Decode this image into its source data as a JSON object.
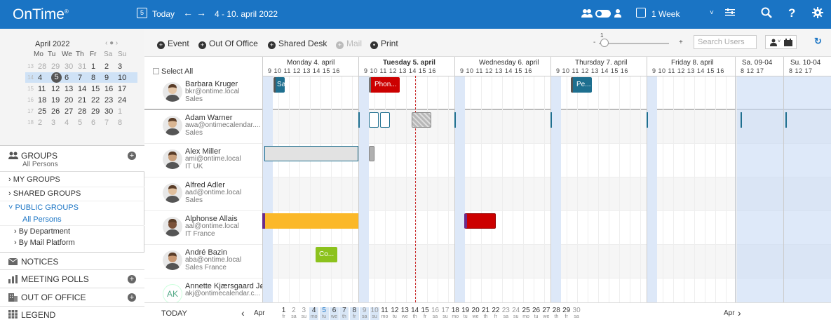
{
  "topbar": {
    "logo": "OnTime",
    "logo_mark": "®",
    "today_icon_num": "5",
    "today": "Today",
    "prev": "←",
    "next": "→",
    "range": "4 - 10. april 2022",
    "view": "1 Week"
  },
  "mini_cal": {
    "month": "April 2022",
    "nav": "‹ ● ›",
    "weekdays": [
      "Mo",
      "Tu",
      "We",
      "Th",
      "Fr",
      "Sa",
      "Su"
    ],
    "weeks": [
      {
        "wk": "13",
        "days": [
          "28",
          "29",
          "30",
          "31",
          "1",
          "2",
          "3"
        ],
        "other": [
          true,
          true,
          true,
          true,
          false,
          false,
          false
        ]
      },
      {
        "wk": "14",
        "days": [
          "4",
          "5",
          "6",
          "7",
          "8",
          "9",
          "10"
        ],
        "other": [
          false,
          false,
          false,
          false,
          false,
          false,
          false
        ]
      },
      {
        "wk": "15",
        "days": [
          "11",
          "12",
          "13",
          "14",
          "15",
          "16",
          "17"
        ],
        "other": [
          false,
          false,
          false,
          false,
          false,
          false,
          false
        ]
      },
      {
        "wk": "16",
        "days": [
          "18",
          "19",
          "20",
          "21",
          "22",
          "23",
          "24"
        ],
        "other": [
          false,
          false,
          false,
          false,
          false,
          false,
          false
        ]
      },
      {
        "wk": "17",
        "days": [
          "25",
          "26",
          "27",
          "28",
          "29",
          "30",
          "1"
        ],
        "other": [
          false,
          false,
          false,
          false,
          false,
          false,
          true
        ]
      },
      {
        "wk": "18",
        "days": [
          "2",
          "3",
          "4",
          "5",
          "6",
          "7",
          "8"
        ],
        "other": [
          true,
          true,
          true,
          true,
          true,
          true,
          true
        ]
      }
    ]
  },
  "sidebar": {
    "groups_title": "GROUPS",
    "groups_sub": "All Persons",
    "my_groups": "› MY GROUPS",
    "shared_groups": "› SHARED GROUPS",
    "public_groups": "˅ PUBLIC GROUPS",
    "all_persons": "All Persons",
    "by_department": "By Department",
    "by_mail": "By Mail Platform",
    "notices": "NOTICES",
    "meeting_polls": "MEETING POLLS",
    "out_of_office": "OUT OF OFFICE",
    "legend": "LEGEND"
  },
  "toolbar": {
    "event": "Event",
    "ooo": "Out Of Office",
    "shared_desk": "Shared Desk",
    "mail": "Mail",
    "print": "Print",
    "zoom_value": "1",
    "search_placeholder": "Search Users"
  },
  "select_all": "Select All",
  "people": [
    {
      "name": "Barbara Kruger",
      "mail": "bkr@ontime.local",
      "dept": "Sales",
      "initials": ""
    },
    {
      "name": "Adam Warner",
      "mail": "awa@ontimecalendar....",
      "dept": "Sales",
      "initials": ""
    },
    {
      "name": "Alex Miller",
      "mail": "ami@ontime.local",
      "dept": "IT UK",
      "initials": ""
    },
    {
      "name": "Alfred Adler",
      "mail": "aad@ontime.local",
      "dept": "Sales",
      "initials": ""
    },
    {
      "name": "Alphonse Allais",
      "mail": "aal@ontime.local",
      "dept": "IT France",
      "initials": ""
    },
    {
      "name": "André Bazin",
      "mail": "aba@ontime.local",
      "dept": "Sales France",
      "initials": ""
    },
    {
      "name": "Annette Kjærsgaard Jø...",
      "mail": "akj@ontimecalendar.c...",
      "dept": "",
      "initials": "AK"
    }
  ],
  "days": [
    {
      "label": "Monday 4. april",
      "hours": "9  10  11  12  13  14  15  16"
    },
    {
      "label": "Tuesday 5. april",
      "hours": "9  10  11  12  13  14  15  16"
    },
    {
      "label": "Wednesday 6. april",
      "hours": "9  10  11  12  13  14  15  16"
    },
    {
      "label": "Thursday 7. april",
      "hours": "9  10  11  12  13  14  15  16"
    },
    {
      "label": "Friday 8. april",
      "hours": "9  10  11  12  13  14  15  16"
    },
    {
      "label": "Sa. 09-04",
      "hours": "8    12    17"
    },
    {
      "label": "Su. 10-04",
      "hours": "8    12    17"
    }
  ],
  "events": [
    {
      "text": "Sa...",
      "color": "#1e6f8f"
    },
    {
      "text": "Phon...",
      "color": "#cc0000"
    },
    {
      "text": "Pe...",
      "color": "#1e6f8f"
    },
    {
      "text": "Co...",
      "color": "#8cc21d"
    }
  ],
  "bottom": {
    "today": "TODAY",
    "month_prev": "Apr",
    "month_next": "Apr",
    "prev_arrow": "‹",
    "next_arrow": "›",
    "dates": [
      {
        "d": "1",
        "w": "fr"
      },
      {
        "d": "2",
        "w": "sa"
      },
      {
        "d": "3",
        "w": "su"
      },
      {
        "d": "4",
        "w": "mo"
      },
      {
        "d": "5",
        "w": "tu"
      },
      {
        "d": "6",
        "w": "we"
      },
      {
        "d": "7",
        "w": "th"
      },
      {
        "d": "8",
        "w": "fr"
      },
      {
        "d": "9",
        "w": "sa"
      },
      {
        "d": "10",
        "w": "su"
      },
      {
        "d": "11",
        "w": "mo"
      },
      {
        "d": "12",
        "w": "tu"
      },
      {
        "d": "13",
        "w": "we"
      },
      {
        "d": "14",
        "w": "th"
      },
      {
        "d": "15",
        "w": "fr"
      },
      {
        "d": "16",
        "w": "sa"
      },
      {
        "d": "17",
        "w": "su"
      },
      {
        "d": "18",
        "w": "mo"
      },
      {
        "d": "19",
        "w": "tu"
      },
      {
        "d": "20",
        "w": "we"
      },
      {
        "d": "21",
        "w": "th"
      },
      {
        "d": "22",
        "w": "fr"
      },
      {
        "d": "23",
        "w": "sa"
      },
      {
        "d": "24",
        "w": "su"
      },
      {
        "d": "25",
        "w": "mo"
      },
      {
        "d": "26",
        "w": "tu"
      },
      {
        "d": "27",
        "w": "we"
      },
      {
        "d": "28",
        "w": "th"
      },
      {
        "d": "29",
        "w": "fr"
      },
      {
        "d": "30",
        "w": "sa"
      }
    ]
  },
  "colors": {
    "topbar": "#1a74c4",
    "band": "#dde8f8",
    "blue_event": "#1e6f8f",
    "red_event": "#cc0000",
    "yellow_event": "#fbb829",
    "green_event": "#8cc21d"
  }
}
